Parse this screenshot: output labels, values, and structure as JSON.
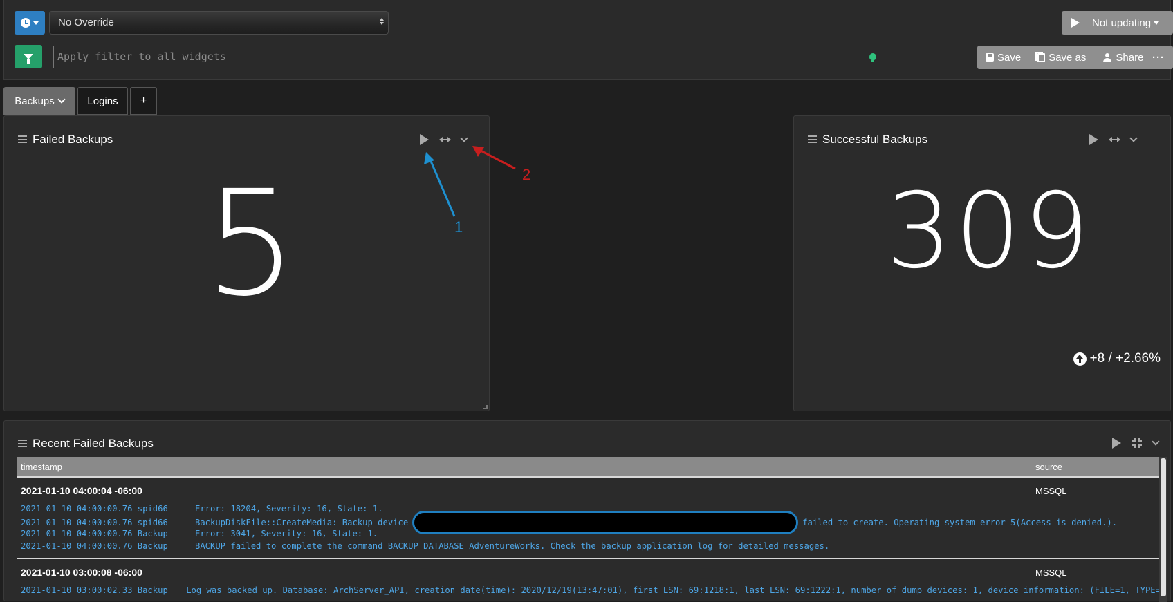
{
  "toolbar": {
    "time_override": "No Override",
    "refresh_label": "Not updating",
    "filter_placeholder": "Apply filter to all widgets",
    "save_label": "Save",
    "save_as_label": "Save as",
    "share_label": "Share",
    "more_label": "···"
  },
  "tabs": [
    {
      "label": "Backups"
    },
    {
      "label": "Logins"
    },
    {
      "label": "+"
    }
  ],
  "widgets": {
    "failed": {
      "title": "Failed Backups",
      "value": "5"
    },
    "success": {
      "title": "Successful Backups",
      "value": "309",
      "trend": "+8 / +2.66%"
    },
    "recent": {
      "title": "Recent Failed Backups"
    }
  },
  "annotations": {
    "arrow1": "1",
    "arrow2": "2"
  },
  "table": {
    "headers": {
      "timestamp": "timestamp",
      "source": "source"
    },
    "groups": [
      {
        "timestamp": "2021-01-10 04:00:04 -06:00",
        "source": "MSSQL",
        "lines": [
          {
            "ts": "2021-01-10 04:00:00.76 spid66",
            "msg": "Error: 18204, Severity: 16, State: 1."
          },
          {
            "ts": "2021-01-10 04:00:00.76 spid66",
            "msg": "BackupDiskFile::CreateMedia: Backup device",
            "msg_after": "failed to create. Operating system error 5(Access is denied.)."
          },
          {
            "ts": "2021-01-10 04:00:00.76 Backup",
            "msg": "Error: 3041, Severity: 16, State: 1."
          },
          {
            "ts": "2021-01-10 04:00:00.76 Backup",
            "msg": "BACKUP failed to complete the command BACKUP DATABASE AdventureWorks. Check the backup application log for detailed messages."
          }
        ]
      },
      {
        "timestamp": "2021-01-10 03:00:08 -06:00",
        "source": "MSSQL",
        "lines": [
          {
            "ts": "2021-01-10 03:00:02.33 Backup",
            "msg": "Log was backed up. Database: ArchServer_API, creation date(time): 2020/12/19(13:47:01), first LSN: 69:1218:1, last LSN: 69:1222:1, number of dump devices: 1, device information: (FILE=1, TYPE="
          }
        ]
      }
    ]
  },
  "colors": {
    "accent_blue": "#2e7fc2",
    "filter_green": "#25a06a",
    "log_blue": "#4ea6e6",
    "arrow_blue": "#1e90d0",
    "arrow_red": "#c81e1e"
  }
}
